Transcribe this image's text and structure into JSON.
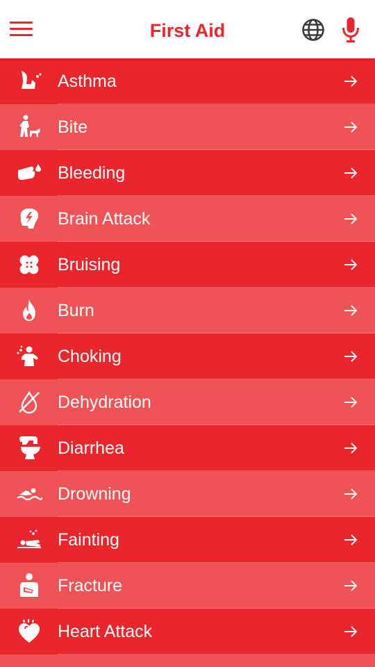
{
  "header": {
    "title": "First Aid",
    "menu_icon": "hamburger-menu-icon",
    "language_icon": "globe-icon",
    "voice_icon": "microphone-icon"
  },
  "colors": {
    "primary": "#e8262b",
    "row_dark": "#e8262b",
    "row_light": "#ef5355",
    "text_on_red": "#ffffff"
  },
  "items": [
    {
      "label": "Asthma",
      "icon": "asthma-icon"
    },
    {
      "label": "Bite",
      "icon": "dog-bite-icon"
    },
    {
      "label": "Bleeding",
      "icon": "bleeding-hand-icon"
    },
    {
      "label": "Brain Attack",
      "icon": "brain-bolt-icon"
    },
    {
      "label": "Bruising",
      "icon": "bandage-icon"
    },
    {
      "label": "Burn",
      "icon": "flame-icon"
    },
    {
      "label": "Choking",
      "icon": "choking-icon"
    },
    {
      "label": "Dehydration",
      "icon": "no-drop-icon"
    },
    {
      "label": "Diarrhea",
      "icon": "toilet-icon"
    },
    {
      "label": "Drowning",
      "icon": "swimmer-icon"
    },
    {
      "label": "Fainting",
      "icon": "fainting-person-icon"
    },
    {
      "label": "Fracture",
      "icon": "arm-sling-icon"
    },
    {
      "label": "Heart Attack",
      "icon": "heart-icon"
    }
  ]
}
